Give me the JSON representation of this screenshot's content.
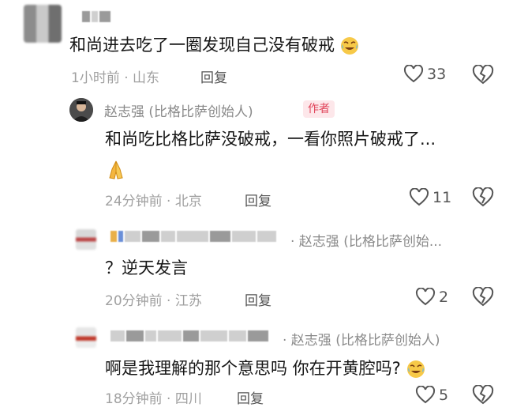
{
  "comments": [
    {
      "text": "和尚进去吃了一圈发现自己没有破戒",
      "time": "1小时前",
      "location": "山东",
      "reply_label": "回复",
      "likes": "33"
    },
    {
      "author": "赵志强 (比格比萨创始人)",
      "badge": "作者",
      "text": "和尚吃比格比萨没破戒，一看你照片破戒了...",
      "time": "24分钟前",
      "location": "北京",
      "reply_label": "回复",
      "likes": "11"
    },
    {
      "reply_to": "· 赵志强 (比格比萨创始...",
      "text": "？逆天发言",
      "time": "20分钟前",
      "location": "江苏",
      "reply_label": "回复",
      "likes": "2"
    },
    {
      "reply_to": "· 赵志强 (比格比萨创始人)",
      "text": "啊是我理解的那个意思吗 你在开黄腔吗?",
      "time": "18分钟前",
      "location": "四川",
      "reply_label": "回复",
      "likes": "5"
    }
  ],
  "separator": " · ",
  "colors": {
    "badge": "#e0445a",
    "meta": "#a0a0a0"
  }
}
